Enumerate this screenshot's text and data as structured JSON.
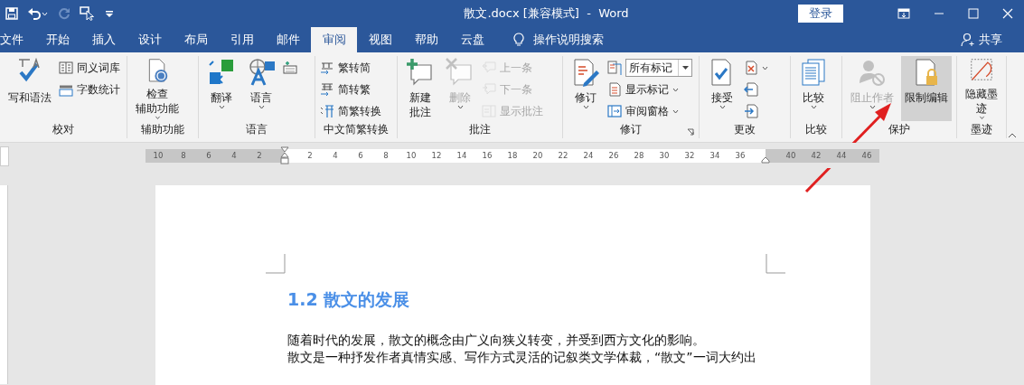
{
  "window": {
    "title": "散文.docx [兼容模式]  -  Word",
    "login_button": "登录"
  },
  "tabs": [
    {
      "label": "文件",
      "selected": false
    },
    {
      "label": "开始",
      "selected": false
    },
    {
      "label": "插入",
      "selected": false
    },
    {
      "label": "设计",
      "selected": false
    },
    {
      "label": "布局",
      "selected": false
    },
    {
      "label": "引用",
      "selected": false
    },
    {
      "label": "邮件",
      "selected": false
    },
    {
      "label": "审阅",
      "selected": true
    },
    {
      "label": "视图",
      "selected": false
    },
    {
      "label": "帮助",
      "selected": false
    },
    {
      "label": "云盘",
      "selected": false
    }
  ],
  "tell_me": "操作说明搜索",
  "share_button": "共享",
  "ribbon": {
    "groups": [
      {
        "label": "校对",
        "launcher": false,
        "items": [
          {
            "kind": "large",
            "lines": [
              "写和语法"
            ],
            "dropdown": false,
            "disabled": false,
            "selected": false
          },
          {
            "kind": "stack",
            "items": [
              {
                "kind": "small",
                "label": "同义词库",
                "dropdown": false,
                "disabled": false
              },
              {
                "kind": "small",
                "label": "字数统计",
                "dropdown": false,
                "disabled": false
              }
            ]
          }
        ]
      },
      {
        "label": "辅助功能",
        "launcher": false,
        "items": [
          {
            "kind": "large",
            "lines": [
              "检查",
              "辅助功能"
            ],
            "dropdown": true,
            "disabled": false,
            "selected": false
          }
        ]
      },
      {
        "label": "语言",
        "launcher": false,
        "items": [
          {
            "kind": "large",
            "lines": [
              "翻译"
            ],
            "dropdown": true,
            "disabled": false,
            "selected": false
          },
          {
            "kind": "large",
            "lines": [
              "语言"
            ],
            "dropdown": true,
            "disabled": false,
            "selected": false
          },
          {
            "kind": "stack",
            "items": [
              {
                "kind": "icon",
                "dropdown": false,
                "disabled": false
              }
            ]
          }
        ]
      },
      {
        "label": "中文简繁转换",
        "launcher": false,
        "items": [
          {
            "kind": "stack",
            "items": [
              {
                "kind": "small",
                "label": "繁转简",
                "dropdown": false,
                "disabled": false
              },
              {
                "kind": "small",
                "label": "简转繁",
                "dropdown": false,
                "disabled": false
              },
              {
                "kind": "small",
                "label": "简繁转换",
                "dropdown": false,
                "disabled": false
              }
            ]
          }
        ]
      },
      {
        "label": "批注",
        "launcher": false,
        "items": [
          {
            "kind": "large",
            "lines": [
              "新建",
              "批注"
            ],
            "dropdown": false,
            "disabled": false,
            "selected": false
          },
          {
            "kind": "large",
            "lines": [
              "删除"
            ],
            "dropdown": true,
            "disabled": true,
            "selected": false
          },
          {
            "kind": "stack",
            "items": [
              {
                "kind": "small",
                "label": "上一条",
                "dropdown": false,
                "disabled": true
              },
              {
                "kind": "small",
                "label": "下一条",
                "dropdown": false,
                "disabled": true
              },
              {
                "kind": "small",
                "label": "显示批注",
                "dropdown": false,
                "disabled": true
              }
            ]
          }
        ]
      },
      {
        "label": "修订",
        "launcher": true,
        "items": [
          {
            "kind": "large",
            "lines": [
              "修订"
            ],
            "dropdown": true,
            "disabled": false,
            "selected": false
          },
          {
            "kind": "stack",
            "items": [
              {
                "kind": "select",
                "value": "所有标记",
                "disabled": false
              },
              {
                "kind": "small",
                "label": "显示标记",
                "dropdown": true,
                "disabled": false
              },
              {
                "kind": "small",
                "label": "审阅窗格",
                "dropdown": true,
                "disabled": false
              }
            ]
          }
        ]
      },
      {
        "label": "更改",
        "launcher": false,
        "items": [
          {
            "kind": "large",
            "lines": [
              "接受"
            ],
            "dropdown": true,
            "disabled": false,
            "selected": false
          },
          {
            "kind": "stack",
            "items": [
              {
                "kind": "icon",
                "dropdown": true,
                "disabled": false
              },
              {
                "kind": "icon",
                "dropdown": false,
                "disabled": false
              },
              {
                "kind": "icon",
                "dropdown": false,
                "disabled": false
              }
            ]
          }
        ]
      },
      {
        "label": "比较",
        "launcher": false,
        "items": [
          {
            "kind": "large",
            "lines": [
              "比较"
            ],
            "dropdown": true,
            "disabled": false,
            "selected": false
          }
        ]
      },
      {
        "label": "保护",
        "launcher": false,
        "items": [
          {
            "kind": "large",
            "lines": [
              "阻止作者"
            ],
            "dropdown": true,
            "disabled": true,
            "selected": false
          },
          {
            "kind": "large",
            "lines": [
              "限制编辑"
            ],
            "dropdown": false,
            "disabled": false,
            "selected": true
          }
        ]
      },
      {
        "label": "墨迹",
        "launcher": false,
        "items": [
          {
            "kind": "large",
            "lines": [
              "隐藏墨",
              "迹"
            ],
            "dropdown": true,
            "disabled": false,
            "selected": false
          }
        ]
      }
    ]
  },
  "ruler": {
    "left_ticks": [
      "10",
      "8",
      "6",
      "4",
      "2"
    ],
    "ticks": [
      "2",
      "4",
      "6",
      "8",
      "10",
      "12",
      "14",
      "16",
      "18",
      "20",
      "22",
      "24",
      "26",
      "28",
      "30",
      "32",
      "34",
      "36"
    ],
    "right_ticks": [
      "40",
      "42",
      "44",
      "46"
    ]
  },
  "document": {
    "heading": "1.2 散文的发展",
    "paragraphs": [
      "随着时代的发展，散文的概念由广义向狭义转变，并受到西方文化的影响。",
      "散文是一种抒发作者真情实感、写作方式灵活的记叙类文学体裁，“散文”一词大约出"
    ]
  }
}
